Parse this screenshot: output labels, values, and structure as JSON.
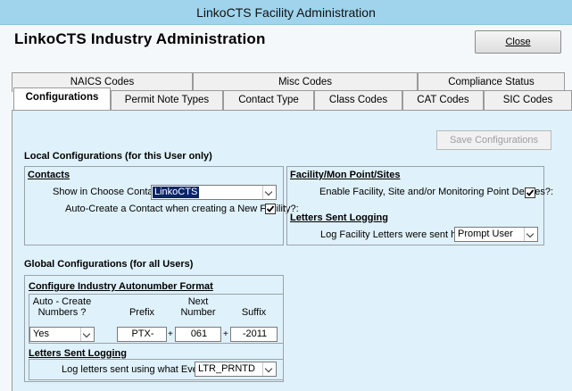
{
  "window": {
    "title": "LinkoCTS Facility Administration"
  },
  "header": {
    "title": "LinkoCTS Industry Administration",
    "close_label": "Close"
  },
  "tabs": {
    "row1": [
      "NAICS Codes",
      "Misc Codes",
      "Compliance Status"
    ],
    "row2": [
      "Configurations",
      "Permit Note Types",
      "Contact Type",
      "Class Codes",
      "CAT Codes",
      "SIC Codes"
    ],
    "active": "Configurations"
  },
  "save_button": "Save Configurations",
  "local": {
    "heading": "Local Configurations  (for this User only)",
    "contacts": {
      "title": "Contacts",
      "show_label": "Show in Choose Contacts:",
      "show_value": "LinkoCTS",
      "autocreate_label": "Auto-Create a Contact when creating a New Facility?:",
      "autocreate_checked": true
    },
    "facility": {
      "title": "Facility/Mon Point/Sites",
      "enable_label": "Enable Facility, Site and/or Monitoring Point Deletes?:",
      "enable_checked": true
    },
    "letters": {
      "title": "Letters Sent Logging",
      "log_label": "Log Facility Letters were sent how?:",
      "log_value": "Prompt User"
    }
  },
  "global": {
    "heading": "Global Configurations  (for all Users)",
    "autonumber": {
      "title": "Configure Industry Autonumber Format",
      "col_auto": "Auto - Create Numbers ?",
      "col_prefix": "Prefix",
      "col_next": "Next Number",
      "col_suffix": "Suffix",
      "auto_value": "Yes",
      "prefix_value": "PTX-",
      "next_value": "061",
      "suffix_value": "-2011",
      "plus": "+"
    },
    "letters": {
      "title": "Letters Sent Logging",
      "event_label": "Log letters sent using what Event?:",
      "event_value": "LTR_PRNTD"
    }
  },
  "colors": {
    "titlebar": "#9fd4ec",
    "panel": "#dff1fa",
    "selection": "#0a246a"
  }
}
